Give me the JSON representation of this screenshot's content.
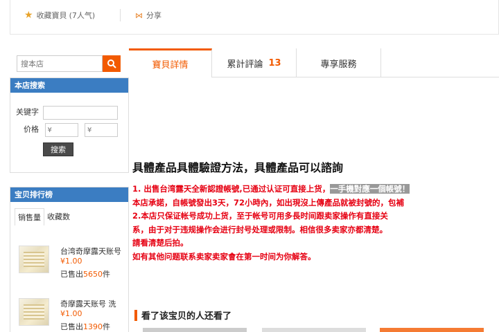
{
  "topbar": {
    "favorite_label": "收藏寶貝",
    "favorite_count": "(7人气)",
    "share_label": "分享"
  },
  "sidebar": {
    "search_placeholder": "搜本店",
    "shop_search_title": "本店搜索",
    "keyword_label": "关键字",
    "price_label": "价格",
    "price_min_placeholder": "¥",
    "price_max_placeholder": "¥",
    "search_button": "搜索",
    "ranking_title": "宝贝排行榜",
    "ranking_tabs": [
      "销售量",
      "收藏数"
    ],
    "ranking_items": [
      {
        "name": "台湾奇摩露天账号",
        "price": "¥1.00",
        "sold_prefix": "已售出",
        "sold_count": "5650",
        "sold_suffix": "件"
      },
      {
        "name": "奇摩露天账号 洗",
        "price": "¥1.00",
        "sold_prefix": "已售出",
        "sold_count": "1390",
        "sold_suffix": "件"
      }
    ]
  },
  "tabs": {
    "details": "寶貝詳情",
    "reviews": "累計評論",
    "reviews_count": "13",
    "services": "專享服務"
  },
  "content": {
    "title": "具體產品具體驗證方法，具體產品可以諮詢",
    "line1_a": "1. 出售台湾露天全新認證帳號,已通过认证可直接上货，",
    "line1_highlight": "一手機對應一個帳號！",
    "line2": "本店承諾，自帳號發出3天，72小時內，如出現沒上傳產品就被封號的，包補",
    "line3": "2.本店只保证帐号成功上货，至于帐号可用多長时间跟卖家操作有直接关",
    "line4": "系，由于对于违规操作会进行封号处理或限制。相信很多卖家亦都清楚。",
    "line5": "請看清楚后拍。",
    "line6": "如有其他问题联系卖家卖家會在第一时间为你解答。",
    "also_viewed": "看了该宝贝的人还看了"
  },
  "colors": {
    "accent": "#f25a00",
    "sidebar_header": "#3b7dc2",
    "notice_red": "#e60012"
  }
}
